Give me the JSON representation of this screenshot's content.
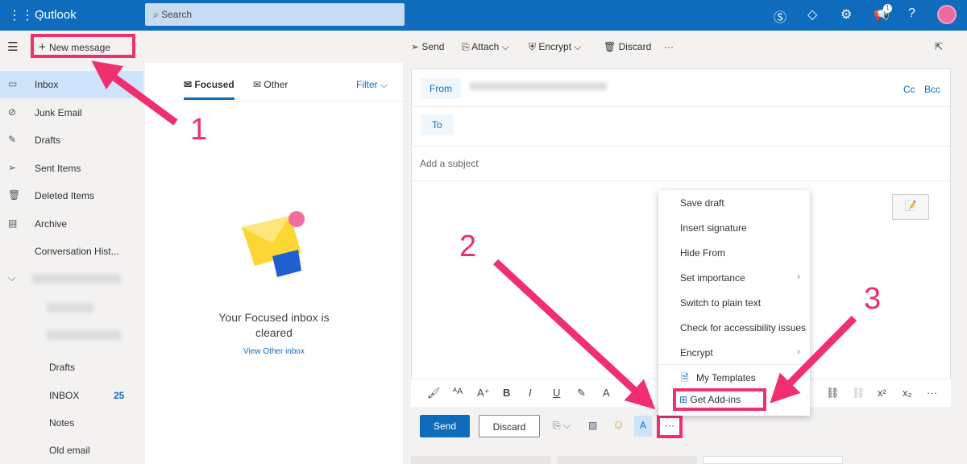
{
  "app": {
    "title": "Outlook",
    "search_placeholder": "Search",
    "notification_count": "1"
  },
  "command_bar": {
    "new_message": "New message",
    "send": "Send",
    "attach": "Attach",
    "encrypt": "Encrypt",
    "discard": "Discard",
    "more": "···"
  },
  "sidebar": {
    "items": [
      {
        "label": "Inbox",
        "icon": "inbox-icon"
      },
      {
        "label": "Junk Email",
        "icon": "block-icon"
      },
      {
        "label": "Drafts",
        "icon": "pencil-icon"
      },
      {
        "label": "Sent Items",
        "icon": "send-icon"
      },
      {
        "label": "Deleted Items",
        "icon": "trash-icon"
      },
      {
        "label": "Archive",
        "icon": "archive-icon"
      },
      {
        "label": "Conversation Hist..."
      }
    ],
    "sub_items": [
      {
        "label": "Drafts"
      },
      {
        "label": "INBOX",
        "count": "25"
      },
      {
        "label": "Notes"
      },
      {
        "label": "Old email"
      }
    ]
  },
  "message_list": {
    "tabs": [
      "Focused",
      "Other"
    ],
    "filter": "Filter",
    "empty_title": "Your Focused inbox is cleared",
    "view_other": "View Other inbox"
  },
  "compose": {
    "from": "From",
    "to": "To",
    "cc": "Cc",
    "bcc": "Bcc",
    "subject_placeholder": "Add a subject",
    "send": "Send",
    "discard": "Discard"
  },
  "more_menu": {
    "items": [
      "Save draft",
      "Insert signature",
      "Hide From",
      "Set importance",
      "Switch to plain text",
      "Check for accessibility issues",
      "Encrypt",
      "My Templates",
      "Get Add-ins"
    ]
  },
  "annotations": {
    "step1": "1",
    "step2": "2",
    "step3": "3"
  },
  "colors": {
    "brand": "#0f6cbd",
    "annotation": "#f0306e"
  }
}
